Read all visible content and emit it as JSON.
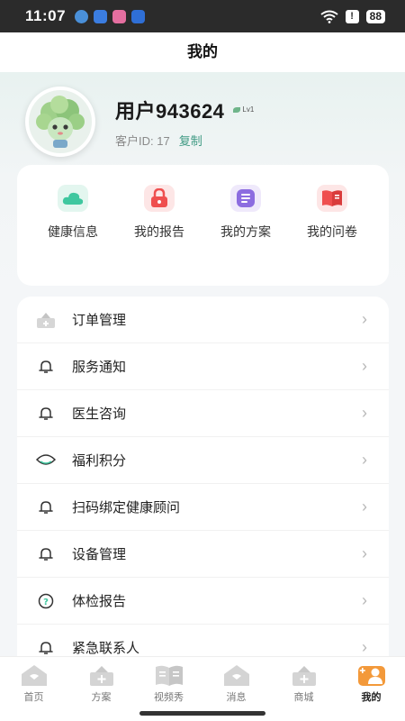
{
  "status_bar": {
    "time": "11:07",
    "battery": "88",
    "icons": [
      "browser-icon",
      "wifi-app-icon",
      "gallery-app-icon",
      "bluetooth-app-icon",
      "wifi-icon",
      "alert-icon",
      "battery-icon"
    ]
  },
  "nav": {
    "title": "我的"
  },
  "profile": {
    "username": "用户943624",
    "level": "Lv1",
    "customer_id_label": "客户ID: 17",
    "copy_label": "复制"
  },
  "shortcuts": [
    {
      "label": "健康信息",
      "icon": "cloud-icon",
      "color": "#3fc79f",
      "bg": "#e3f6ef"
    },
    {
      "label": "我的报告",
      "icon": "lock-report-icon",
      "color": "#ef4f4f",
      "bg": "#fde6e6"
    },
    {
      "label": "我的方案",
      "icon": "document-icon",
      "color": "#8c6ce0",
      "bg": "#efe9fb"
    },
    {
      "label": "我的问卷",
      "icon": "book-icon",
      "color": "#ef4f4f",
      "bg": "#fde6e6"
    }
  ],
  "menu": [
    {
      "label": "订单管理",
      "icon": "order-icon"
    },
    {
      "label": "服务通知",
      "icon": "bell-icon"
    },
    {
      "label": "医生咨询",
      "icon": "bell-icon"
    },
    {
      "label": "福利积分",
      "icon": "points-icon"
    },
    {
      "label": "扫码绑定健康顾问",
      "icon": "bell-icon"
    },
    {
      "label": "设备管理",
      "icon": "bell-icon"
    },
    {
      "label": "体检报告",
      "icon": "question-icon"
    },
    {
      "label": "紧急联系人",
      "icon": "bell-icon"
    }
  ],
  "tabs": [
    {
      "label": "首页",
      "icon": "home-icon",
      "active": false
    },
    {
      "label": "方案",
      "icon": "plan-icon",
      "active": false
    },
    {
      "label": "视频秀",
      "icon": "video-book-icon",
      "active": false
    },
    {
      "label": "消息",
      "icon": "message-icon",
      "active": false
    },
    {
      "label": "商城",
      "icon": "shop-icon",
      "active": false
    },
    {
      "label": "我的",
      "icon": "mine-icon",
      "active": true
    }
  ],
  "colors": {
    "accent": "#3f9a83",
    "active_tab": "#f3993a"
  }
}
